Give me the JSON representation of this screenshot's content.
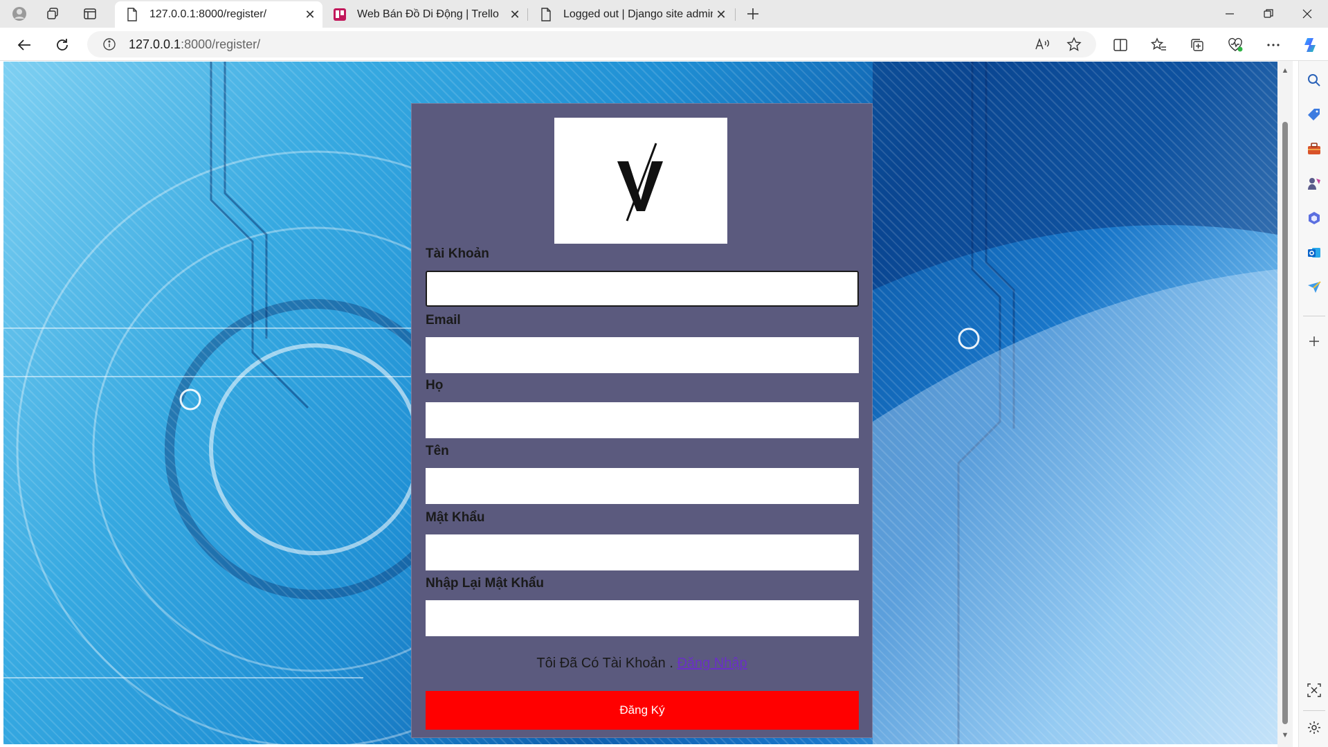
{
  "browser": {
    "tabs": [
      {
        "title": "127.0.0.1:8000/register/",
        "active": true,
        "icon": "page-icon"
      },
      {
        "title": "Web Bán Đồ Di Động | Trello",
        "active": false,
        "icon": "trello-icon"
      },
      {
        "title": "Logged out | Django site admin",
        "active": false,
        "icon": "page-icon"
      }
    ],
    "address": {
      "host": "127.0.0.1",
      "path": ":8000/register/"
    }
  },
  "form": {
    "fields": [
      {
        "label": "Tài Khoản",
        "value": ""
      },
      {
        "label": "Email",
        "value": ""
      },
      {
        "label": "Họ",
        "value": ""
      },
      {
        "label": "Tên",
        "value": ""
      },
      {
        "label": "Mật Khẩu",
        "value": ""
      },
      {
        "label": "Nhập Lại Mật Khẩu",
        "value": ""
      }
    ],
    "login_prompt": "Tôi Đã Có Tài Khoản .",
    "login_link": "Đăng Nhập",
    "submit_label": "Đăng Ký"
  },
  "colors": {
    "panel": "#5b5a7e",
    "submit": "#ff0000",
    "link": "#6a2fc7"
  }
}
